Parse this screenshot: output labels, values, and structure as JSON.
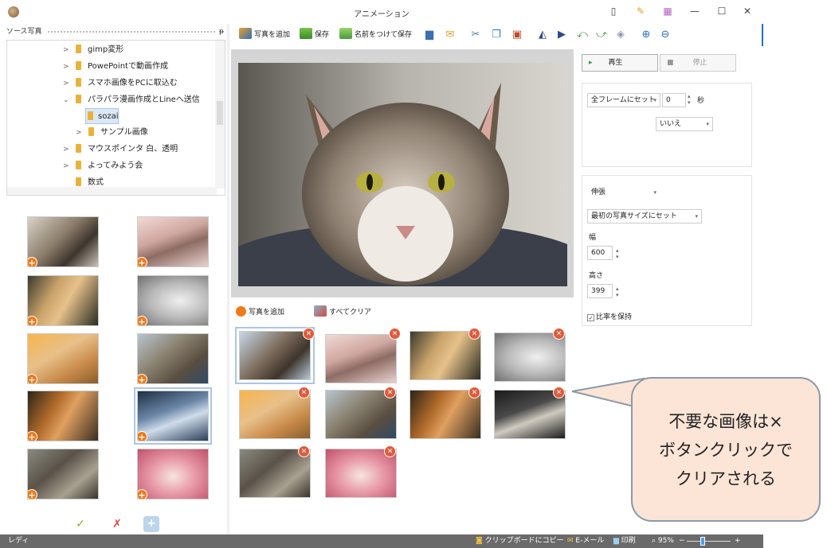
{
  "window": {
    "title": "アニメーション",
    "controls": [
      "—",
      "☐",
      "✕"
    ]
  },
  "source": {
    "header": "ソース写真",
    "pin": "ᵽ",
    "tree": [
      {
        "label": "gimp変形",
        "expanded": false
      },
      {
        "label": "PowePointで動画作成",
        "expanded": false
      },
      {
        "label": "スマホ画像をPCに取込む",
        "expanded": false
      },
      {
        "label": "パラパラ漫画作成とLineへ送信",
        "expanded": true
      },
      {
        "label": "sozai",
        "selected": true
      },
      {
        "label": "サンプル画像",
        "expanded": false
      },
      {
        "label": "マウスポインタ 白、透明",
        "expanded": false
      },
      {
        "label": "よってみよう会",
        "expanded": false
      },
      {
        "label": "数式"
      }
    ],
    "actions": {
      "check": "✓",
      "x": "✗",
      "add": "+"
    }
  },
  "toolbar": {
    "add_photo": "写真を追加",
    "save": "保存",
    "save_as": "名前をつけて保存"
  },
  "gallery": {
    "add_photo": "写真を追加",
    "clear_all": "すべてクリア"
  },
  "right": {
    "play": "再生",
    "stop": "停止",
    "frame_set": "全フレームにセット",
    "seconds_value": "0",
    "seconds_label": "秒",
    "loop_option": "いいえ",
    "stretch": "伸張",
    "size_mode": "最初の写真サイズにセット",
    "width_label": "幅",
    "width_value": "600",
    "height_label": "高さ",
    "height_value": "399",
    "keep_ratio": "比率を保持"
  },
  "status": {
    "ready": "レディ",
    "copy": "クリップボードにコピー",
    "email": "E-メール",
    "print": "印刷",
    "zoom": "95%",
    "minus": "−",
    "plus": "+"
  },
  "callout": {
    "line1": "不要な画像は×",
    "line2": "ボタンクリックで",
    "line3": "クリアされる"
  },
  "colors": {
    "accent": "#1a6fd6",
    "close_badge": "#e25a3a",
    "plus_badge": "#f07a1a",
    "callout_fill": "#fce4d6",
    "statusbar": "#6a6a6a"
  }
}
